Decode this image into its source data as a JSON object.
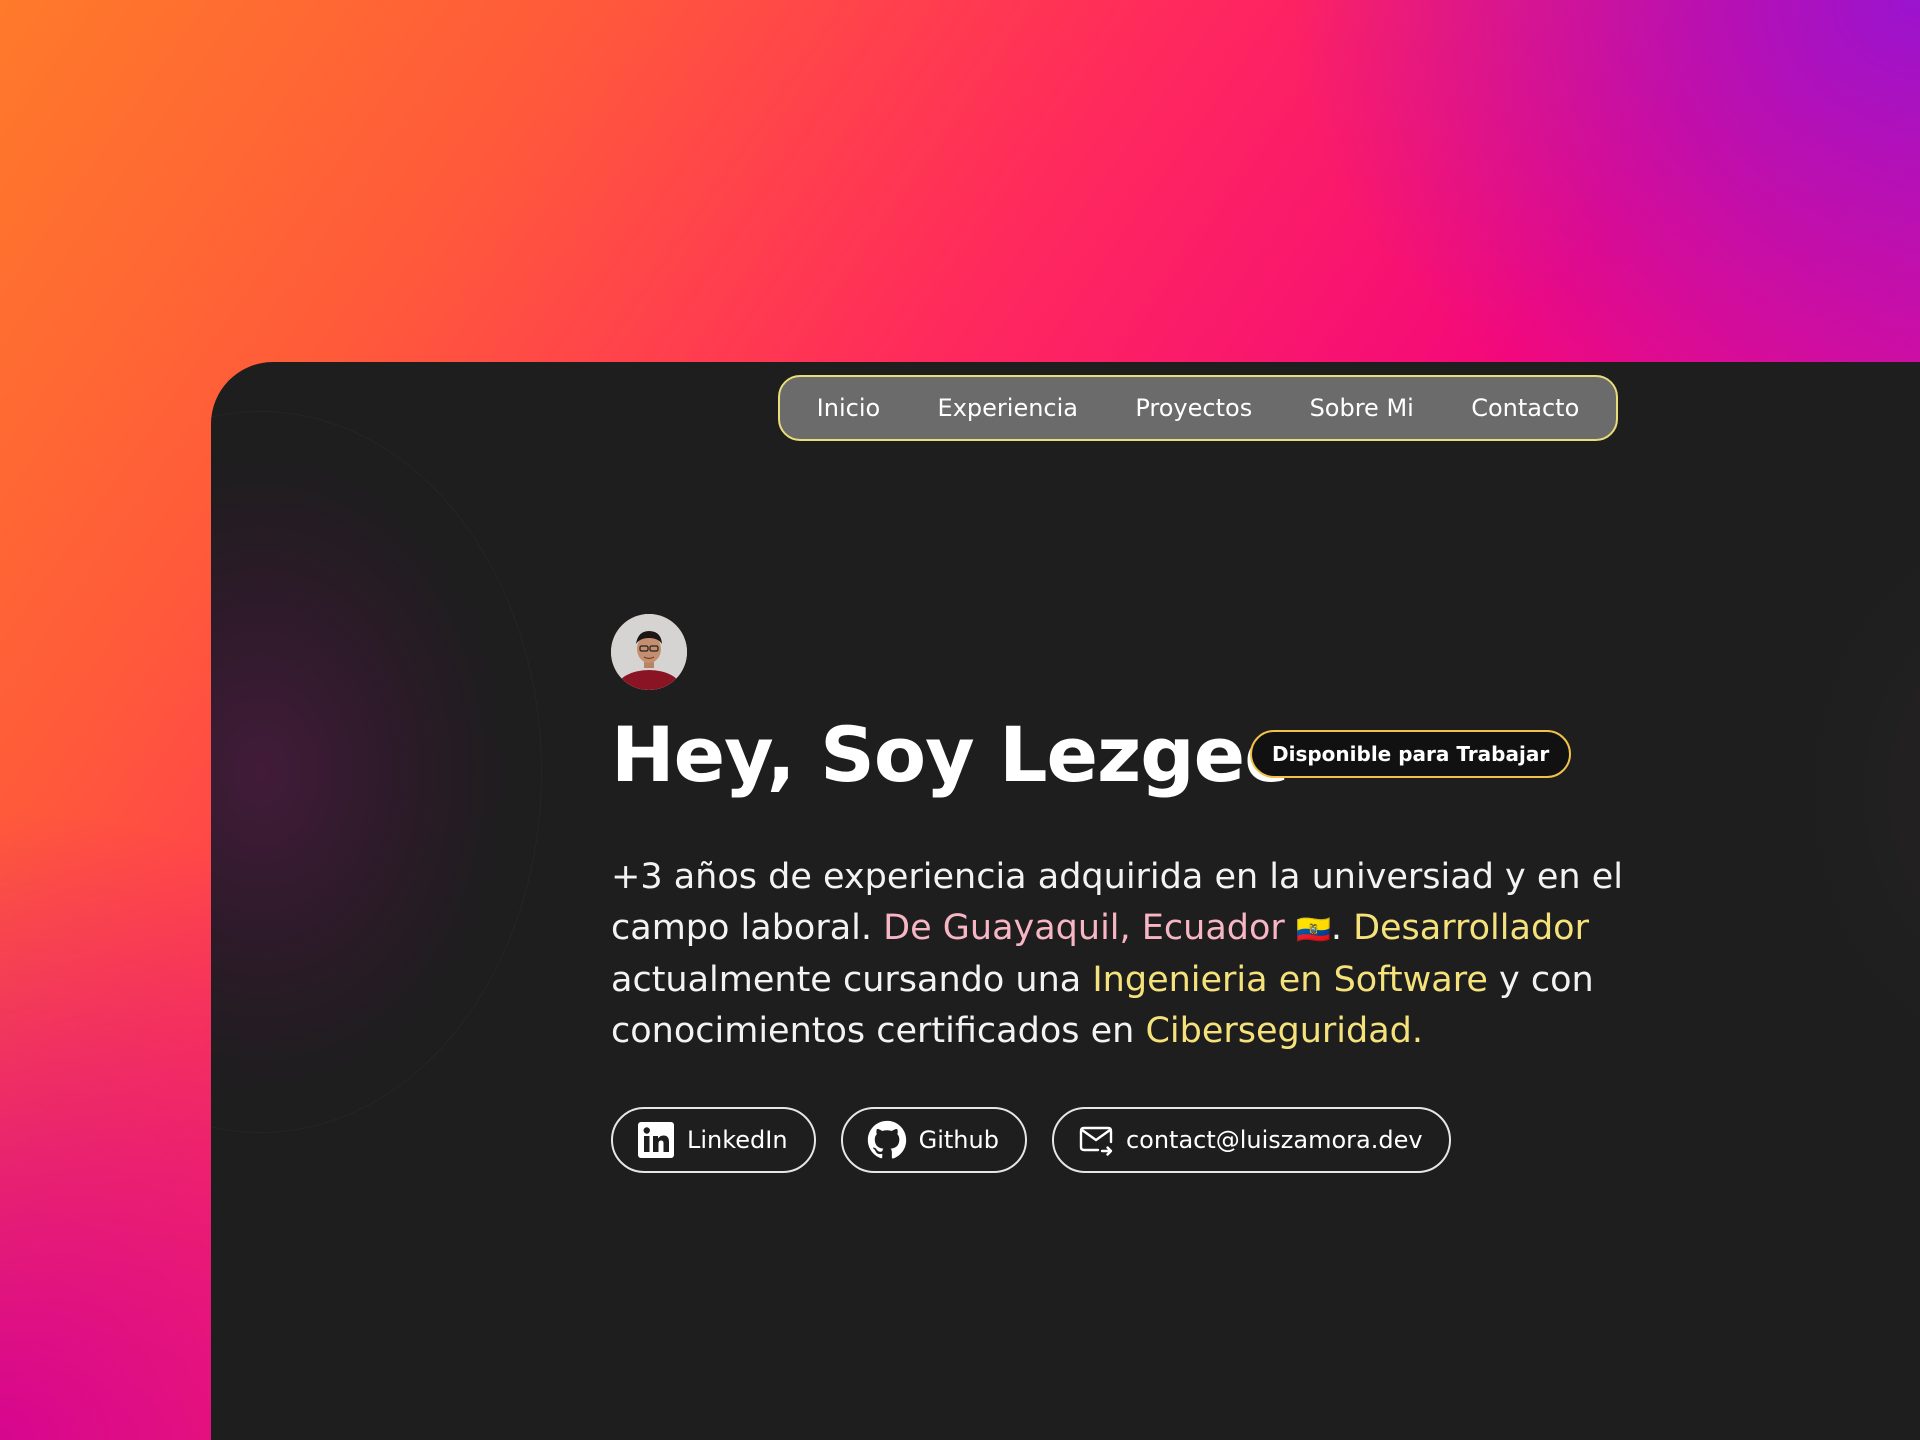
{
  "nav": {
    "items": [
      {
        "label": "Inicio"
      },
      {
        "label": "Experiencia"
      },
      {
        "label": "Proyectos"
      },
      {
        "label": "Sobre Mi"
      },
      {
        "label": "Contacto"
      }
    ]
  },
  "hero": {
    "avatar_icon": "profile-photo",
    "title": "Hey, Soy Lezgec",
    "badge": "Disponible para Trabajar",
    "bio": {
      "p1": "+3 años de experiencia adquirida en la universiad y en el campo laboral. ",
      "location": "De Guayaquil, Ecuador",
      "flag": "🇪🇨",
      "p2": ". ",
      "role": "Desarrollador",
      "p3": " actualmente cursando una ",
      "degree": "Ingenieria en Software",
      "p4": " y con conocimientos certificados en ",
      "cert": "Ciberseguridad."
    }
  },
  "links": [
    {
      "label": "LinkedIn",
      "icon": "linkedin-icon"
    },
    {
      "label": "Github",
      "icon": "github-icon"
    },
    {
      "label": "contact@luiszamora.dev",
      "icon": "mail-icon"
    }
  ],
  "colors": {
    "accent_pink": "#f8b6c4",
    "accent_yellow": "#f5e27a",
    "nav_border": "#e9dc7a",
    "badge_border": "#f0c24a",
    "window_bg": "#1e1e1e"
  }
}
